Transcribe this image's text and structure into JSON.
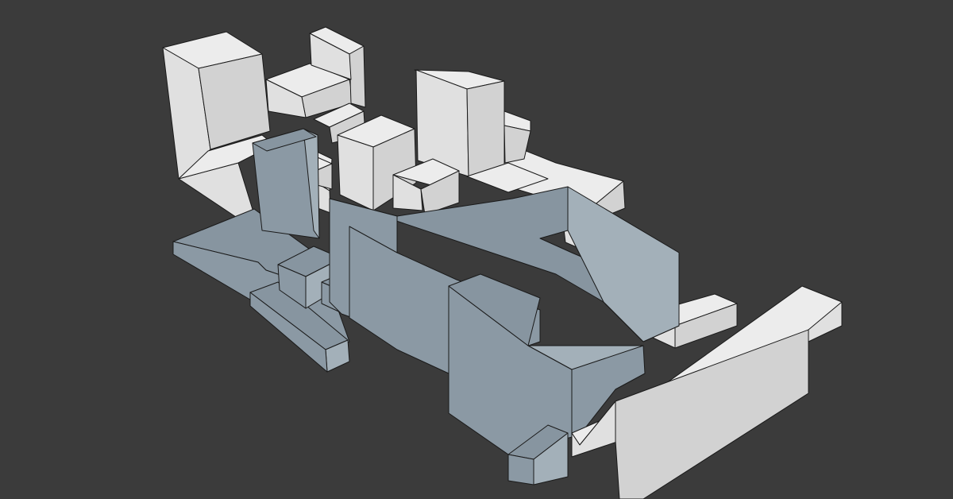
{
  "scene": {
    "background_color": "#3b3b3b",
    "context_massing": {
      "top_color": "#ececec",
      "side_light_color": "#e0e0e0",
      "side_dark_color": "#d2d2d2"
    },
    "proposed_massing": {
      "top_color": "#8795a0",
      "side_light_color": "#8b99a4",
      "side_dark_color": "#a3b0b9"
    },
    "edge_color": "#1a1a1a"
  }
}
